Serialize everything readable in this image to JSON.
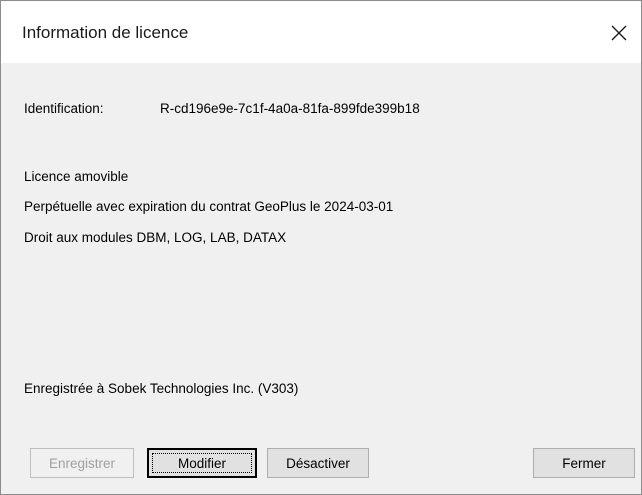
{
  "window": {
    "title": "Information de licence",
    "close_icon": "close-icon"
  },
  "license": {
    "identification_label": "Identification:",
    "identification_value": "R-cd196e9e-7c1f-4a0a-81fa-899fde399b18",
    "type": "Licence amovible",
    "expiration": "Perpétuelle avec expiration du contrat GeoPlus le 2024-03-01",
    "modules": "Droit aux modules DBM, LOG, LAB, DATAX",
    "registered_to": "Enregistrée à Sobek Technologies Inc. (V303)"
  },
  "buttons": {
    "register": "Enregistrer",
    "modify": "Modifier",
    "deactivate": "Désactiver",
    "close": "Fermer"
  },
  "colors": {
    "client_background": "#f0f0f0",
    "titlebar_background": "#ffffff",
    "disabled_text": "#a0a0a0"
  }
}
